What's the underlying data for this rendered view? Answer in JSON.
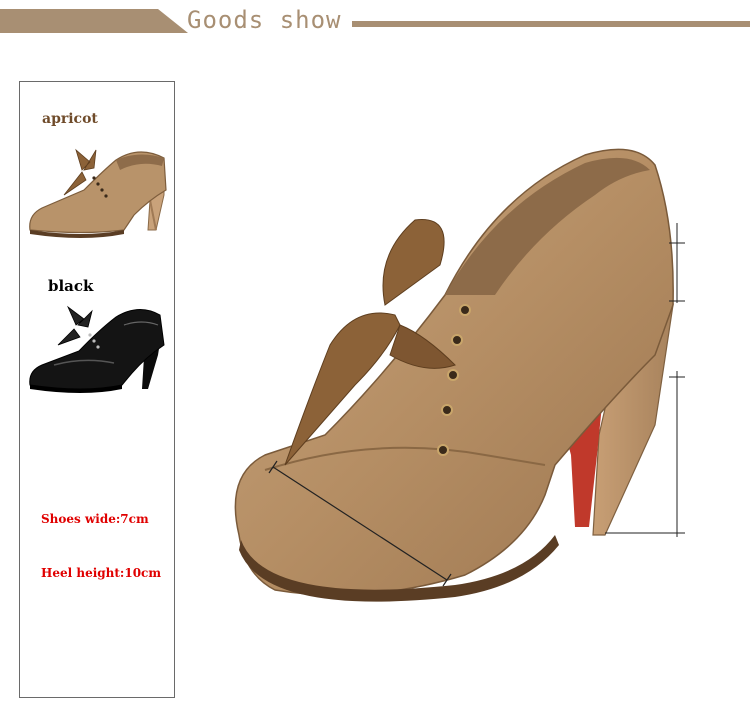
{
  "header": {
    "title": "Goods show"
  },
  "colors": {
    "accent": "#a88f73",
    "apricot_leather": "#b8936a",
    "black_leather": "#111111",
    "spec_text": "#e00000",
    "sole_red": "#c0392b"
  },
  "variants": [
    {
      "label": "apricot"
    },
    {
      "label": "black"
    }
  ],
  "specs": {
    "shoes_wide": "Shoes wide:7cm",
    "heel_height": "Heel height:10cm"
  }
}
